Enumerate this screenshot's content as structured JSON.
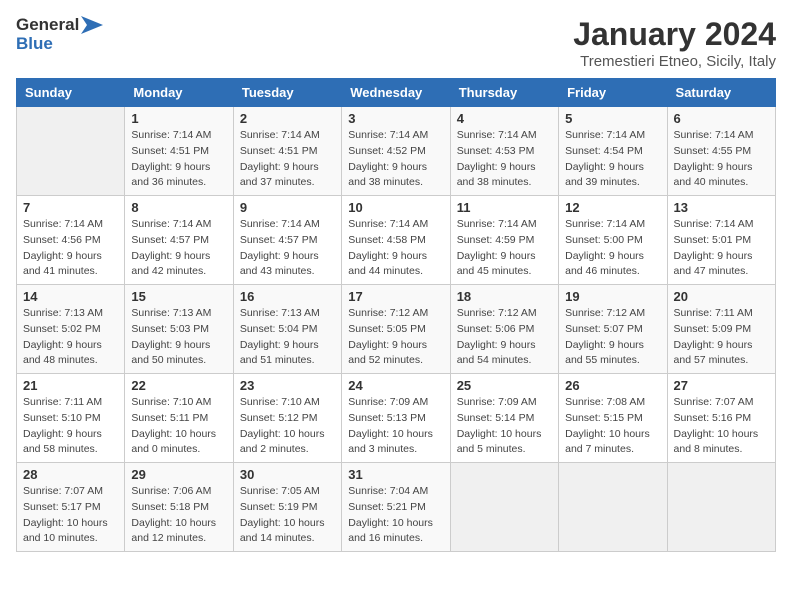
{
  "logo": {
    "text_general": "General",
    "text_blue": "Blue"
  },
  "title": "January 2024",
  "subtitle": "Tremestieri Etneo, Sicily, Italy",
  "days_of_week": [
    "Sunday",
    "Monday",
    "Tuesday",
    "Wednesday",
    "Thursday",
    "Friday",
    "Saturday"
  ],
  "weeks": [
    [
      {
        "day": "",
        "detail": ""
      },
      {
        "day": "1",
        "detail": "Sunrise: 7:14 AM\nSunset: 4:51 PM\nDaylight: 9 hours\nand 36 minutes."
      },
      {
        "day": "2",
        "detail": "Sunrise: 7:14 AM\nSunset: 4:51 PM\nDaylight: 9 hours\nand 37 minutes."
      },
      {
        "day": "3",
        "detail": "Sunrise: 7:14 AM\nSunset: 4:52 PM\nDaylight: 9 hours\nand 38 minutes."
      },
      {
        "day": "4",
        "detail": "Sunrise: 7:14 AM\nSunset: 4:53 PM\nDaylight: 9 hours\nand 38 minutes."
      },
      {
        "day": "5",
        "detail": "Sunrise: 7:14 AM\nSunset: 4:54 PM\nDaylight: 9 hours\nand 39 minutes."
      },
      {
        "day": "6",
        "detail": "Sunrise: 7:14 AM\nSunset: 4:55 PM\nDaylight: 9 hours\nand 40 minutes."
      }
    ],
    [
      {
        "day": "7",
        "detail": "Sunrise: 7:14 AM\nSunset: 4:56 PM\nDaylight: 9 hours\nand 41 minutes."
      },
      {
        "day": "8",
        "detail": "Sunrise: 7:14 AM\nSunset: 4:57 PM\nDaylight: 9 hours\nand 42 minutes."
      },
      {
        "day": "9",
        "detail": "Sunrise: 7:14 AM\nSunset: 4:57 PM\nDaylight: 9 hours\nand 43 minutes."
      },
      {
        "day": "10",
        "detail": "Sunrise: 7:14 AM\nSunset: 4:58 PM\nDaylight: 9 hours\nand 44 minutes."
      },
      {
        "day": "11",
        "detail": "Sunrise: 7:14 AM\nSunset: 4:59 PM\nDaylight: 9 hours\nand 45 minutes."
      },
      {
        "day": "12",
        "detail": "Sunrise: 7:14 AM\nSunset: 5:00 PM\nDaylight: 9 hours\nand 46 minutes."
      },
      {
        "day": "13",
        "detail": "Sunrise: 7:14 AM\nSunset: 5:01 PM\nDaylight: 9 hours\nand 47 minutes."
      }
    ],
    [
      {
        "day": "14",
        "detail": "Sunrise: 7:13 AM\nSunset: 5:02 PM\nDaylight: 9 hours\nand 48 minutes."
      },
      {
        "day": "15",
        "detail": "Sunrise: 7:13 AM\nSunset: 5:03 PM\nDaylight: 9 hours\nand 50 minutes."
      },
      {
        "day": "16",
        "detail": "Sunrise: 7:13 AM\nSunset: 5:04 PM\nDaylight: 9 hours\nand 51 minutes."
      },
      {
        "day": "17",
        "detail": "Sunrise: 7:12 AM\nSunset: 5:05 PM\nDaylight: 9 hours\nand 52 minutes."
      },
      {
        "day": "18",
        "detail": "Sunrise: 7:12 AM\nSunset: 5:06 PM\nDaylight: 9 hours\nand 54 minutes."
      },
      {
        "day": "19",
        "detail": "Sunrise: 7:12 AM\nSunset: 5:07 PM\nDaylight: 9 hours\nand 55 minutes."
      },
      {
        "day": "20",
        "detail": "Sunrise: 7:11 AM\nSunset: 5:09 PM\nDaylight: 9 hours\nand 57 minutes."
      }
    ],
    [
      {
        "day": "21",
        "detail": "Sunrise: 7:11 AM\nSunset: 5:10 PM\nDaylight: 9 hours\nand 58 minutes."
      },
      {
        "day": "22",
        "detail": "Sunrise: 7:10 AM\nSunset: 5:11 PM\nDaylight: 10 hours\nand 0 minutes."
      },
      {
        "day": "23",
        "detail": "Sunrise: 7:10 AM\nSunset: 5:12 PM\nDaylight: 10 hours\nand 2 minutes."
      },
      {
        "day": "24",
        "detail": "Sunrise: 7:09 AM\nSunset: 5:13 PM\nDaylight: 10 hours\nand 3 minutes."
      },
      {
        "day": "25",
        "detail": "Sunrise: 7:09 AM\nSunset: 5:14 PM\nDaylight: 10 hours\nand 5 minutes."
      },
      {
        "day": "26",
        "detail": "Sunrise: 7:08 AM\nSunset: 5:15 PM\nDaylight: 10 hours\nand 7 minutes."
      },
      {
        "day": "27",
        "detail": "Sunrise: 7:07 AM\nSunset: 5:16 PM\nDaylight: 10 hours\nand 8 minutes."
      }
    ],
    [
      {
        "day": "28",
        "detail": "Sunrise: 7:07 AM\nSunset: 5:17 PM\nDaylight: 10 hours\nand 10 minutes."
      },
      {
        "day": "29",
        "detail": "Sunrise: 7:06 AM\nSunset: 5:18 PM\nDaylight: 10 hours\nand 12 minutes."
      },
      {
        "day": "30",
        "detail": "Sunrise: 7:05 AM\nSunset: 5:19 PM\nDaylight: 10 hours\nand 14 minutes."
      },
      {
        "day": "31",
        "detail": "Sunrise: 7:04 AM\nSunset: 5:21 PM\nDaylight: 10 hours\nand 16 minutes."
      },
      {
        "day": "",
        "detail": ""
      },
      {
        "day": "",
        "detail": ""
      },
      {
        "day": "",
        "detail": ""
      }
    ]
  ]
}
